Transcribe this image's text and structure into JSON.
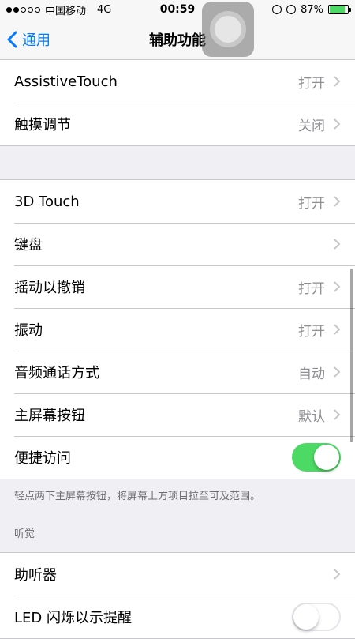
{
  "status_bar": {
    "carrier": "中国移动",
    "network": "4G",
    "time": "00:59",
    "battery_percent": "87%",
    "battery_level": 0.87
  },
  "nav": {
    "back_label": "通用",
    "title": "辅助功能"
  },
  "group1": {
    "items": [
      {
        "label": "AssistiveTouch",
        "value": "打开"
      },
      {
        "label": "触摸调节",
        "value": "关闭"
      }
    ]
  },
  "group2": {
    "items": [
      {
        "label": "3D Touch",
        "value": "打开"
      },
      {
        "label": "键盘",
        "value": ""
      },
      {
        "label": "摇动以撤销",
        "value": "打开"
      },
      {
        "label": "振动",
        "value": "打开"
      },
      {
        "label": "音频通话方式",
        "value": "自动"
      },
      {
        "label": "主屏幕按钮",
        "value": "默认"
      },
      {
        "label": "便捷访问",
        "toggle": true
      }
    ],
    "footer": "轻点两下主屏幕按钮，将屏幕上方项目拉至可及范围。"
  },
  "hearing": {
    "header": "听觉",
    "items": [
      {
        "label": "助听器",
        "value": ""
      },
      {
        "label": "LED 闪烁以示提醒",
        "toggle": false
      }
    ]
  },
  "colors": {
    "accent": "#007aff",
    "toggle_on": "#4cd964",
    "secondary_text": "#8e8e93"
  }
}
